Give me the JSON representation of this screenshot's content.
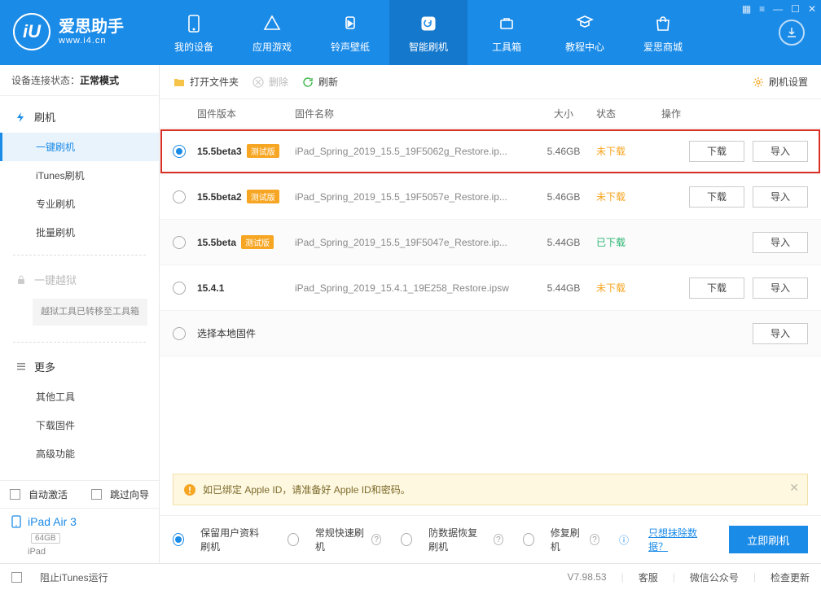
{
  "app": {
    "name": "爱思助手",
    "url": "www.i4.cn",
    "logo_letters": "iU"
  },
  "tabs": [
    {
      "id": "device",
      "label": "我的设备"
    },
    {
      "id": "apps",
      "label": "应用游戏"
    },
    {
      "id": "ring",
      "label": "铃声壁纸"
    },
    {
      "id": "flash",
      "label": "智能刷机",
      "active": true
    },
    {
      "id": "tools",
      "label": "工具箱"
    },
    {
      "id": "tutorial",
      "label": "教程中心"
    },
    {
      "id": "store",
      "label": "爱思商城"
    }
  ],
  "connection": {
    "label": "设备连接状态：",
    "value": "正常模式"
  },
  "sidebar": {
    "flash": {
      "head": "刷机",
      "items": [
        {
          "label": "一键刷机",
          "active": true
        },
        {
          "label": "iTunes刷机"
        },
        {
          "label": "专业刷机"
        },
        {
          "label": "批量刷机"
        }
      ]
    },
    "jailbreak": {
      "head": "一键越狱",
      "note": "越狱工具已转移至工具箱"
    },
    "more": {
      "head": "更多",
      "items": [
        {
          "label": "其他工具"
        },
        {
          "label": "下载固件"
        },
        {
          "label": "高级功能"
        }
      ]
    },
    "auto_activate": "自动激活",
    "skip_guide": "跳过向导"
  },
  "device": {
    "name": "iPad Air 3",
    "storage": "64GB",
    "type": "iPad"
  },
  "toolbar": {
    "open": "打开文件夹",
    "delete": "删除",
    "refresh": "刷新",
    "settings": "刷机设置"
  },
  "columns": {
    "version": "固件版本",
    "name": "固件名称",
    "size": "大小",
    "status": "状态",
    "action": "操作"
  },
  "badge_text": "测试版",
  "actions": {
    "download": "下载",
    "import": "导入"
  },
  "firmware": [
    {
      "version": "15.5beta3",
      "beta": true,
      "name": "iPad_Spring_2019_15.5_19F5062g_Restore.ip...",
      "size": "5.46GB",
      "status": "未下载",
      "status_cls": "no",
      "selected": true,
      "highlight": true,
      "show_dl": true
    },
    {
      "version": "15.5beta2",
      "beta": true,
      "name": "iPad_Spring_2019_15.5_19F5057e_Restore.ip...",
      "size": "5.46GB",
      "status": "未下载",
      "status_cls": "no",
      "show_dl": true
    },
    {
      "version": "15.5beta",
      "beta": true,
      "name": "iPad_Spring_2019_15.5_19F5047e_Restore.ip...",
      "size": "5.44GB",
      "status": "已下载",
      "status_cls": "yes",
      "show_dl": false
    },
    {
      "version": "15.4.1",
      "beta": false,
      "name": "iPad_Spring_2019_15.4.1_19E258_Restore.ipsw",
      "size": "5.44GB",
      "status": "未下载",
      "status_cls": "no",
      "show_dl": true
    }
  ],
  "local_row": "选择本地固件",
  "notice": "如已绑定 Apple ID，请准备好 Apple ID和密码。",
  "footer": {
    "options": [
      {
        "label": "保留用户资料刷机",
        "selected": true
      },
      {
        "label": "常规快速刷机",
        "help": true
      },
      {
        "label": "防数据恢复刷机",
        "help": true
      },
      {
        "label": "修复刷机",
        "help": true
      }
    ],
    "info_icon": "ⓘ",
    "erase_link": "只想抹除数据？",
    "go": "立即刷机"
  },
  "statusbar": {
    "block_itunes": "阻止iTunes运行",
    "version": "V7.98.53",
    "links": [
      "客服",
      "微信公众号",
      "检查更新"
    ]
  }
}
